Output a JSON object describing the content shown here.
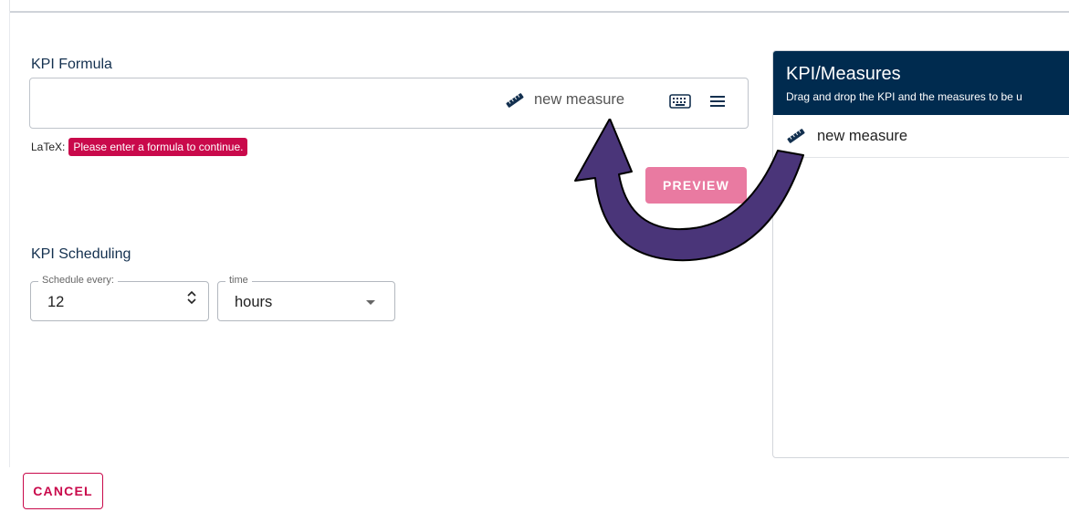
{
  "formula": {
    "title": "KPI Formula",
    "chip_label": "new measure",
    "latex_label": "LaTeX:",
    "error_message": "Please enter a formula to continue.",
    "preview_label": "PREVIEW"
  },
  "scheduling": {
    "title": "KPI Scheduling",
    "schedule_label": "Schedule every:",
    "schedule_value": "12",
    "time_label": "time",
    "time_value": "hours"
  },
  "actions": {
    "cancel_label": "CANCEL"
  },
  "measures_panel": {
    "title": "KPI/Measures",
    "subtitle": "Drag and drop the KPI and the measures to be u",
    "items": [
      {
        "label": "new measure",
        "icon": "ruler-icon"
      }
    ]
  },
  "icons": {
    "chip": "ruler-icon",
    "keyboard": "keyboard-icon",
    "menu": "menu-icon",
    "stepper_up": "chevron-up-icon",
    "stepper_down": "chevron-down-icon",
    "dropdown": "dropdown-arrow-icon"
  },
  "colors": {
    "primary_dark": "#002b4f",
    "accent": "#c9094b",
    "preview_disabled": "#e97aa1",
    "annotation_arrow": "#4a3579"
  }
}
